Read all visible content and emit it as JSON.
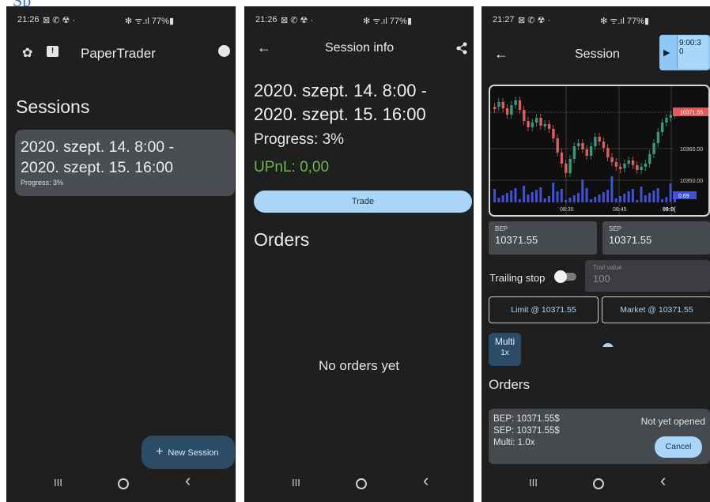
{
  "colors": {
    "bg": "#1f1f1f",
    "accent": "#a8d6fb",
    "fab": "#2c4c66",
    "card": "#4a4e52",
    "positive": "#6fb54a",
    "bull": "#2f9c7e",
    "bear": "#e05c5c",
    "volume": "#3f52d4"
  },
  "top_peek": "Sp",
  "panel1": {
    "status": {
      "time": "21:26",
      "system": "⊠ ✆ ☢ ·",
      "right": "✻ ᯤ.ıl 77%▮"
    },
    "app_title": "PaperTrader",
    "icons": [
      "gear-icon",
      "feedback-icon",
      "account-icon"
    ],
    "sessions_heading": "Sessions",
    "session_card": {
      "line1": "2020. szept. 14. 8:00 -",
      "line2": "2020. szept. 15. 16:00",
      "progress": "Progress: 3%"
    },
    "new_session": {
      "plus": "+",
      "label": "New Session"
    },
    "nav": {
      "recents": "III",
      "back": "‹"
    }
  },
  "panel2": {
    "status": {
      "time": "21:26",
      "system": "⊠ ✆ ☢ ·",
      "right": "✻ ᯤ.ıl 77%▮"
    },
    "title": "Session info",
    "dates_line1": "2020. szept. 14. 8:00 -",
    "dates_line2": "2020. szept. 15. 16:00",
    "progress": "Progress: 3%",
    "upnl": "UPnL: 0,00",
    "trade_label": "Trade",
    "orders_heading": "Orders",
    "no_orders": "No orders yet",
    "nav": {
      "recents": "III",
      "back": "‹"
    }
  },
  "panel3": {
    "status": {
      "time": "21:27",
      "system": "⊠ ✆ ☢ ·",
      "right": "✻ ᯤ.ıl 77%▮"
    },
    "title": "Session",
    "play_icon": "▶",
    "time_line1": "9:00:3",
    "time_line2": "0",
    "chart": {
      "price_labels": [
        "10371.55",
        "10360.00",
        "10350.00"
      ],
      "volume_label": "0.69",
      "time_labels": [
        "08:30",
        "08:45",
        "09:0("
      ]
    },
    "bep": {
      "label": "BEP",
      "value": "10371.55"
    },
    "sep": {
      "label": "SEP",
      "value": "10371.55"
    },
    "trailing_stop": "Trailing stop",
    "trail_value": {
      "label": "Trail value",
      "placeholder": "100"
    },
    "limit_button": "Limit @ 10371.55",
    "market_button": "Market @ 10371.55",
    "multi": {
      "label": "Multi",
      "value": "1x"
    },
    "multiplier_slider": {
      "min": 1,
      "value": 5,
      "max": 10
    },
    "orders_heading": "Orders",
    "order": {
      "bep": "BEP: 10371.55$",
      "sep": "SEP: 10371.55$",
      "multi": "Multi: 1.0x",
      "status": "Not yet opened",
      "cancel": "Cancel"
    },
    "nav": {
      "recents": "III",
      "back": "‹"
    }
  }
}
